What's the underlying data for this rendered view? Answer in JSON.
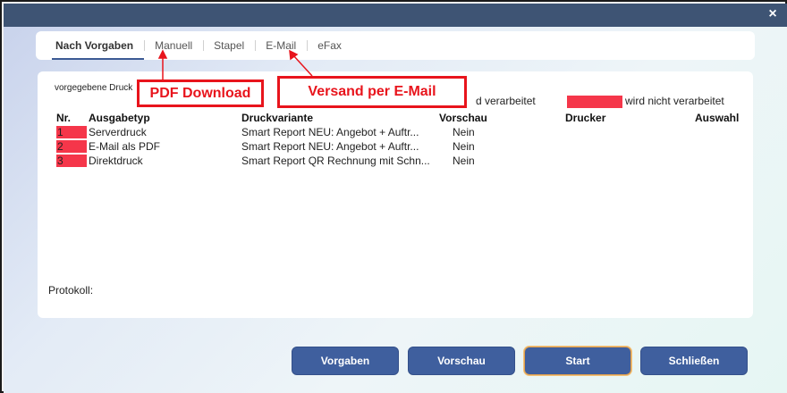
{
  "tabs": [
    {
      "label": "Nach Vorgaben",
      "active": true
    },
    {
      "label": "Manuell",
      "active": false
    },
    {
      "label": "Stapel",
      "active": false
    },
    {
      "label": "E-Mail",
      "active": false
    },
    {
      "label": "eFax",
      "active": false
    }
  ],
  "panel": {
    "caption": "vorgegebene Druck",
    "legend_processed": "d verarbeitet",
    "legend_not_processed": "wird nicht verarbeitet",
    "columns": {
      "nr": "Nr.",
      "ausgabetyp": "Ausgabetyp",
      "druckvariante": "Druckvariante",
      "vorschau": "Vorschau",
      "drucker": "Drucker",
      "auswahl": "Auswahl"
    },
    "rows": [
      {
        "nr": "1",
        "ausgabetyp": "Serverdruck",
        "druckvariante": "Smart Report NEU: Angebot + Auftr...",
        "vorschau": "Nein"
      },
      {
        "nr": "2",
        "ausgabetyp": "E-Mail als PDF",
        "druckvariante": "Smart Report NEU: Angebot + Auftr...",
        "vorschau": "Nein"
      },
      {
        "nr": "3",
        "ausgabetyp": "Direktdruck",
        "druckvariante": "Smart Report QR Rechnung mit Schn...",
        "vorschau": "Nein"
      }
    ],
    "protokoll_label": "Protokoll:"
  },
  "annotations": {
    "pdf_download": "PDF Download",
    "versand_email": "Versand per E-Mail"
  },
  "buttons": {
    "vorgaben": "Vorgaben",
    "vorschau": "Vorschau",
    "start": "Start",
    "schliessen": "Schließen"
  },
  "close_icon": "×",
  "colors": {
    "title_bar": "#3e5474",
    "button": "#3f5f9e",
    "highlight_red": "#f5364a",
    "callout_red": "#e8141c"
  }
}
